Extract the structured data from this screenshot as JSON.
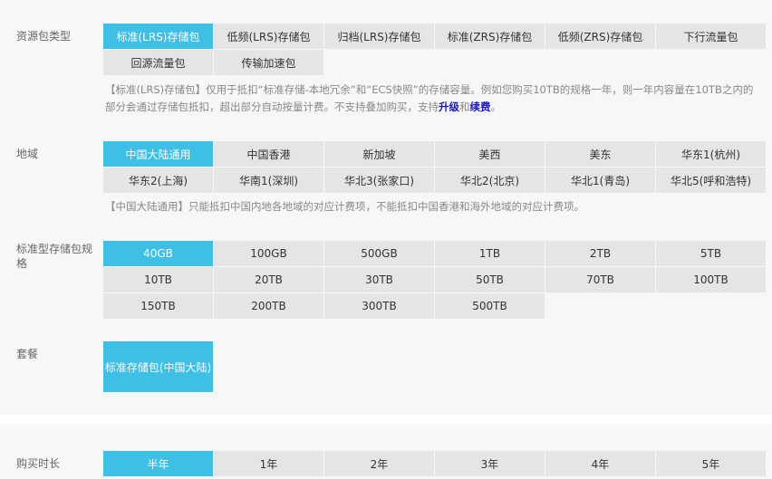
{
  "package_type": {
    "label": "资源包类型",
    "options": [
      "标准(LRS)存储包",
      "低频(LRS)存储包",
      "归档(LRS)存储包",
      "标准(ZRS)存储包",
      "低频(ZRS)存储包",
      "下行流量包",
      "回源流量包",
      "传输加速包"
    ],
    "selected": 0,
    "note_prefix": "【标准(LRS)存储包】仅用于抵扣“标准存储-本地冗余”和“ECS快照”的存储容量。例如您购买10TB的规格一年，则一年内容量在10TB之内的部分会通过存储包抵扣，超出部分自动按量计费。不支持叠加购买，支持",
    "link_upgrade": "升级",
    "note_and": "和",
    "link_renew": "续费",
    "note_end": "。"
  },
  "region": {
    "label": "地域",
    "options": [
      "中国大陆通用",
      "中国香港",
      "新加坡",
      "美西",
      "美东",
      "华东1(杭州)",
      "华东2(上海)",
      "华南1(深圳)",
      "华北3(张家口)",
      "华北2(北京)",
      "华北1(青岛)",
      "华北5(呼和浩特)"
    ],
    "selected": 0,
    "note": "【中国大陆通用】只能抵扣中国内地各地域的对应计费项，不能抵扣中国香港和海外地域的对应计费项。"
  },
  "spec": {
    "label": "标准型存储包规格",
    "options": [
      "40GB",
      "100GB",
      "500GB",
      "1TB",
      "2TB",
      "5TB",
      "10TB",
      "20TB",
      "30TB",
      "50TB",
      "70TB",
      "100TB",
      "150TB",
      "200TB",
      "300TB",
      "500TB"
    ],
    "selected": 0
  },
  "package": {
    "label": "套餐",
    "option": "标准存储包(中国大陆)"
  },
  "duration": {
    "label": "购买时长",
    "options": [
      "半年",
      "1年",
      "2年",
      "3年",
      "4年",
      "5年"
    ],
    "selected": 0
  },
  "colors": {
    "selected": "#3dbfe6",
    "option": "#e5e5e5",
    "link": "#1a1acc"
  }
}
